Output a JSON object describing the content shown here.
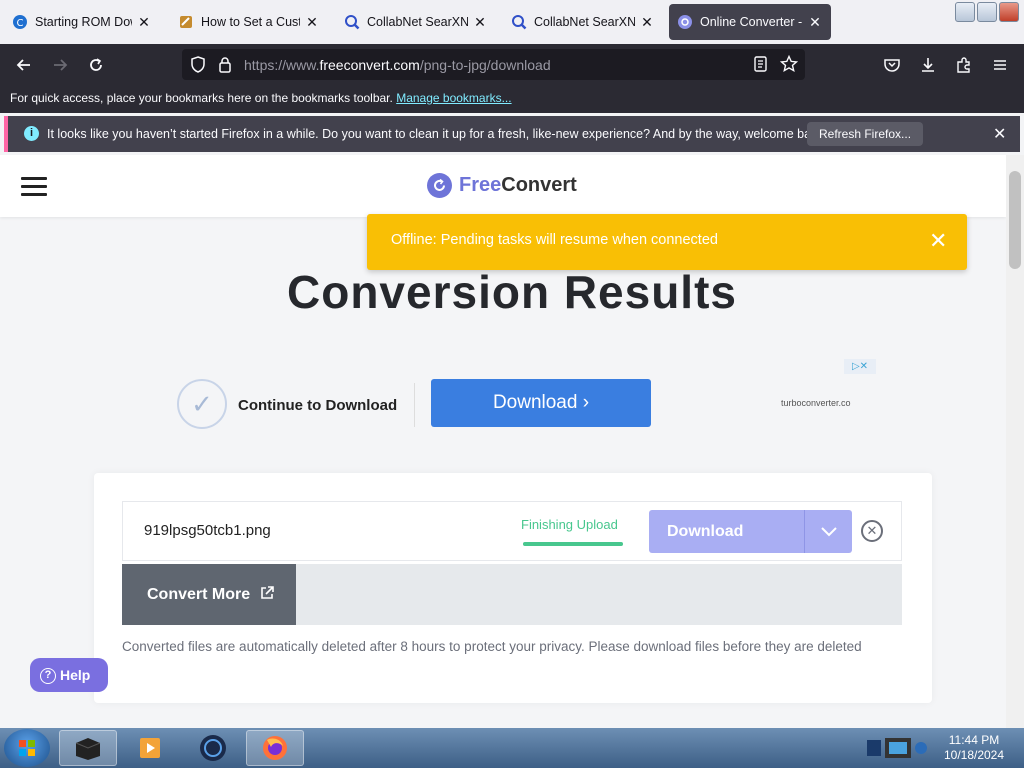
{
  "browser": {
    "tabs": [
      {
        "title": "Starting ROM Downl",
        "icon": "c-logo-icon"
      },
      {
        "title": "How to Set a Custom",
        "icon": "site-favicon-icon"
      },
      {
        "title": "CollabNet SearXNG",
        "icon": "magnifier-icon"
      },
      {
        "title": "CollabNet SearXNG",
        "icon": "magnifier-icon"
      },
      {
        "title": "Online Converter - C",
        "icon": "freeconvert-icon",
        "active": true
      }
    ],
    "url_prefix": "https://www.",
    "url_domain": "freeconvert.com",
    "url_path": "/png-to-jpg/download",
    "bookmarks_text": "For quick access, place your bookmarks here on the bookmarks toolbar.",
    "bookmarks_link": "Manage bookmarks...",
    "notification": "It looks like you haven’t started Firefox in a while. Do you want to clean it up for a fresh, like-new experience? And by the way, welcome back!",
    "refresh_label": "Refresh Firefox..."
  },
  "site": {
    "brand_free": "Free",
    "brand_convert": "Convert",
    "offline_message": "Offline: Pending tasks will resume when connected",
    "page_title": "Conversion Results",
    "ad": {
      "continue_label": "Continue to Download",
      "download_label": "Download",
      "domain": "turboconverter.co"
    },
    "file": {
      "name": "919lpsg50tcb1.png",
      "status": "Finishing Upload",
      "progress": 1.0,
      "download_label": "Download"
    },
    "convert_more_label": "Convert More",
    "note": "Converted files are automatically deleted after 8 hours to protect your privacy. Please download files before they are deleted",
    "help_label": "Help"
  },
  "taskbar": {
    "time": "11:44 PM",
    "date": "10/18/2024"
  },
  "colors": {
    "accent": "#6e74d8",
    "offline_banner": "#f9bf05",
    "download_button": "#3a7ee0",
    "status_green": "#48c78e"
  }
}
